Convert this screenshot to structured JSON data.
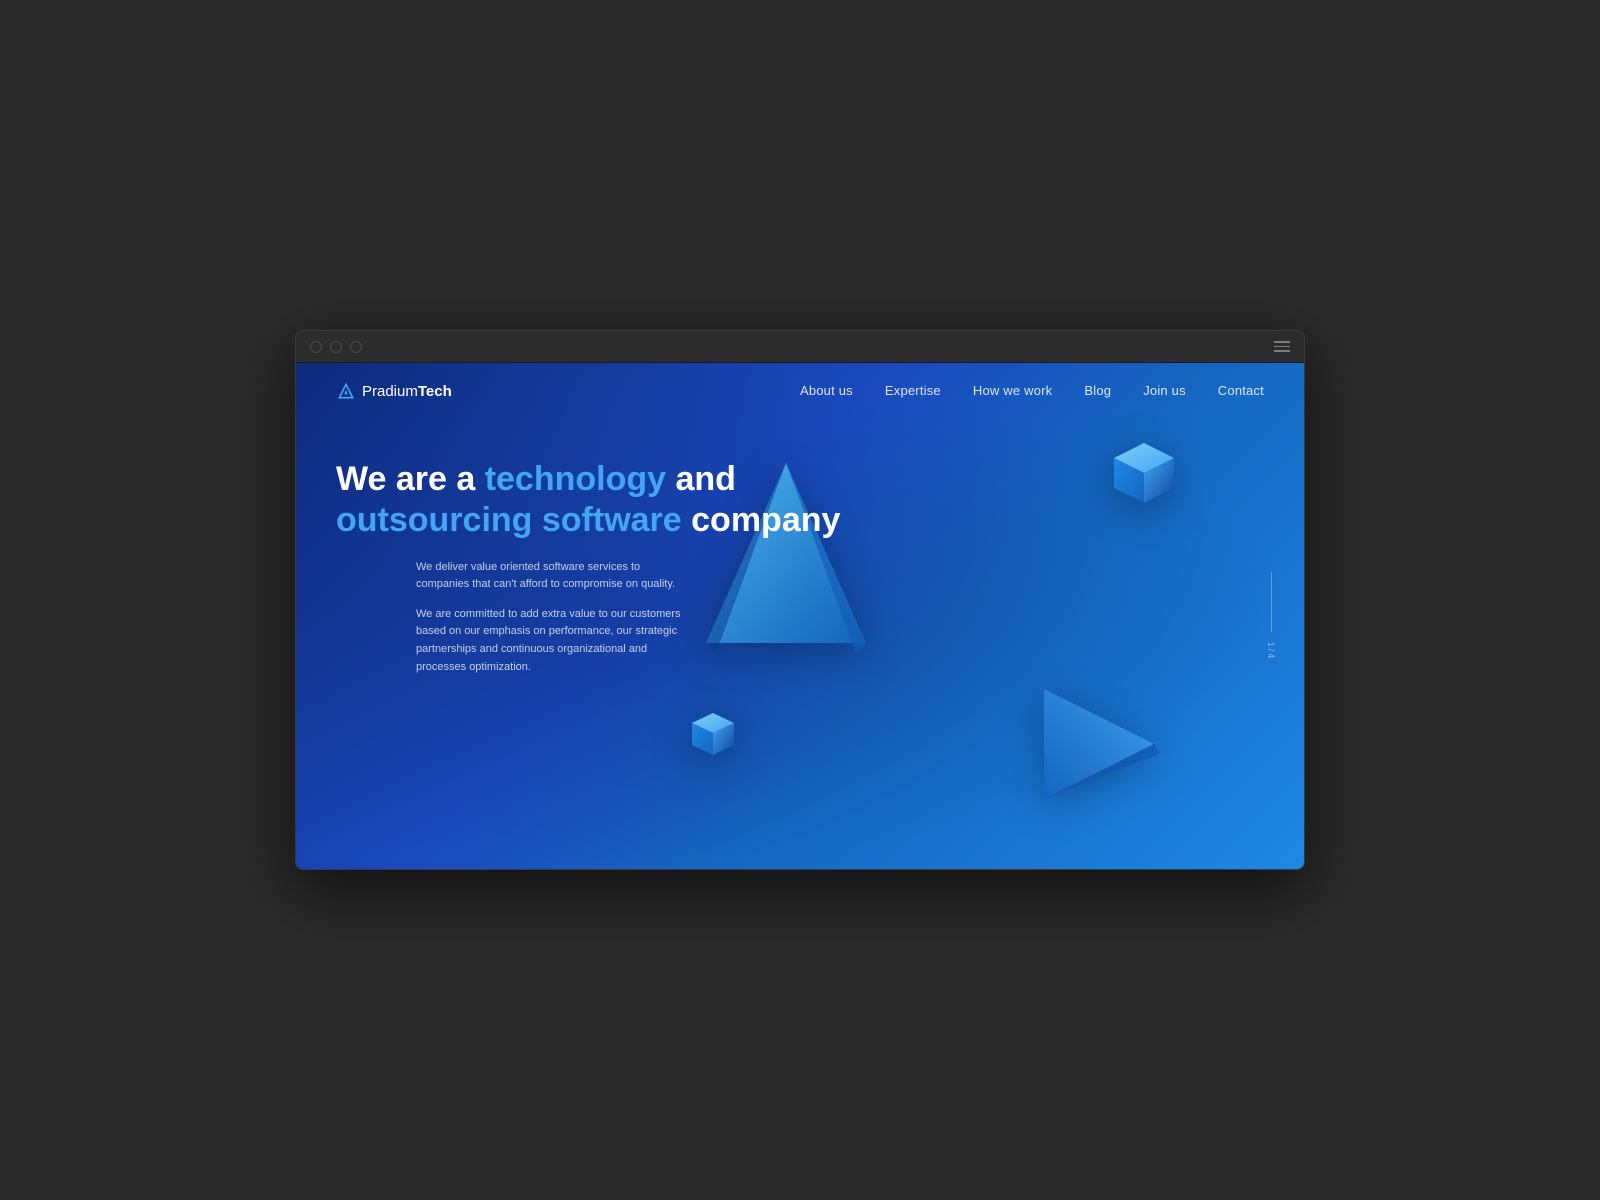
{
  "browser": {
    "title": "PradiumTech"
  },
  "nav": {
    "logo": {
      "text_pradium": "Pradium",
      "text_tech": "Tech"
    },
    "links": [
      {
        "label": "About us",
        "id": "about-us"
      },
      {
        "label": "Expertise",
        "id": "expertise"
      },
      {
        "label": "How we work",
        "id": "how-we-work"
      },
      {
        "label": "Blog",
        "id": "blog"
      },
      {
        "label": "Join us",
        "id": "join-us"
      },
      {
        "label": "Contact",
        "id": "contact"
      }
    ]
  },
  "hero": {
    "line1_prefix": "We are a ",
    "line1_accent": "technology",
    "line1_suffix": " and",
    "line2_accent": "outsourcing software",
    "line2_suffix": " company",
    "desc1": "We deliver value oriented software services to companies that can't afford to compromise on quality.",
    "desc2": "We are committed to add extra value to our customers based on our emphasis on performance, our strategic partnerships and continuous organizational and processes optimization.",
    "slide_current": "1",
    "slide_separator": "/",
    "slide_total": "4"
  },
  "colors": {
    "accent_blue": "#42a5f5",
    "shape_blue_light": "#4fc3f7",
    "shape_blue_mid": "#1976d2",
    "shape_blue_dark": "#0d47a1"
  }
}
